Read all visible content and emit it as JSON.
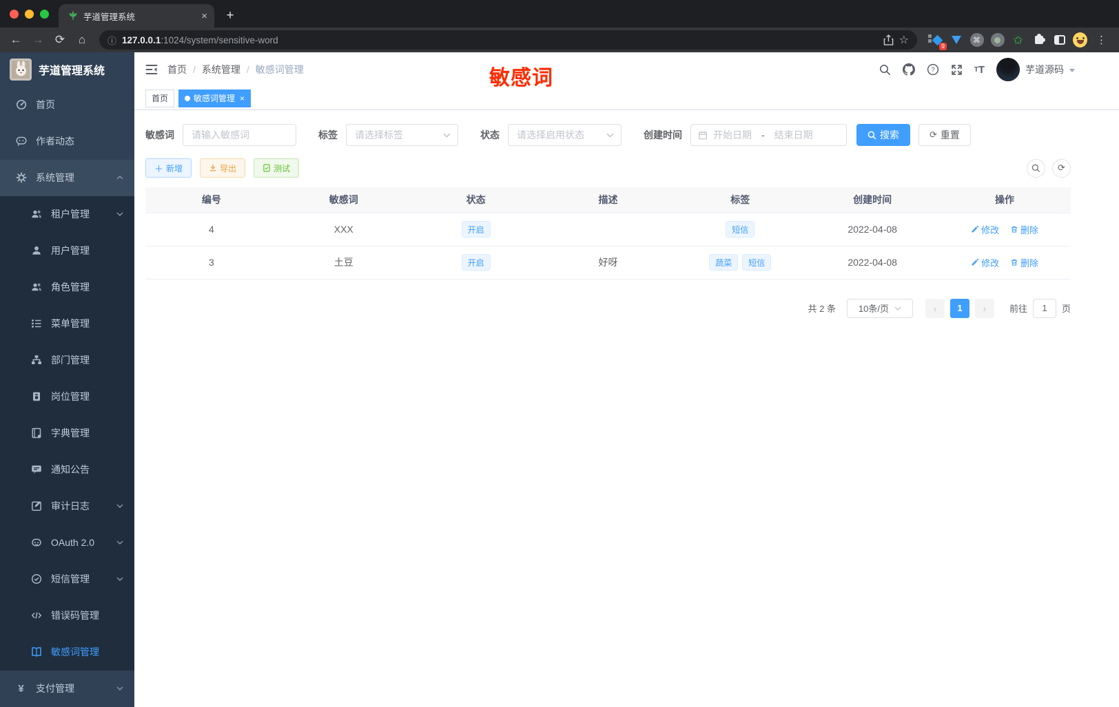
{
  "browser": {
    "tab_title": "芋道管理系统",
    "url_host": "127.0.0.1",
    "url_path": ":1024/system/sensitive-word",
    "extension_badge": "9",
    "new_tab_label": "+",
    "close_label": "×"
  },
  "sidebar": {
    "app_title": "芋道管理系统",
    "items": [
      {
        "label": "首页"
      },
      {
        "label": "作者动态"
      },
      {
        "label": "系统管理"
      },
      {
        "label": "租户管理"
      },
      {
        "label": "用户管理"
      },
      {
        "label": "角色管理"
      },
      {
        "label": "菜单管理"
      },
      {
        "label": "部门管理"
      },
      {
        "label": "岗位管理"
      },
      {
        "label": "字典管理"
      },
      {
        "label": "通知公告"
      },
      {
        "label": "审计日志"
      },
      {
        "label": "OAuth 2.0"
      },
      {
        "label": "短信管理"
      },
      {
        "label": "错误码管理"
      },
      {
        "label": "敏感词管理"
      },
      {
        "label": "支付管理"
      }
    ]
  },
  "navbar": {
    "breadcrumb": {
      "home": "首页",
      "section": "系统管理",
      "current": "敏感词管理"
    },
    "annotation": "敏感词",
    "annotation_color": "#fe2c00",
    "username": "芋道源码"
  },
  "tags_view": {
    "home": "首页",
    "active": "敏感词管理",
    "close": "×"
  },
  "filters": {
    "keyword_label": "敏感词",
    "keyword_placeholder": "请输入敏感词",
    "tag_label": "标签",
    "tag_placeholder": "请选择标签",
    "status_label": "状态",
    "status_placeholder": "请选择启用状态",
    "date_label": "创建时间",
    "date_start_placeholder": "开始日期",
    "date_separator": "-",
    "date_end_placeholder": "结束日期",
    "search_label": "搜索",
    "reset_label": "重置"
  },
  "toolbar": {
    "add_label": "新增",
    "export_label": "导出",
    "test_label": "测试"
  },
  "table": {
    "headers": {
      "id": "编号",
      "word": "敏感词",
      "status": "状态",
      "desc": "描述",
      "tags": "标签",
      "created": "创建时间",
      "ops": "操作"
    },
    "rows": [
      {
        "id": "4",
        "word": "XXX",
        "status": "开启",
        "desc": "",
        "tag1": "短信",
        "created": "2022-04-08"
      },
      {
        "id": "3",
        "word": "土豆",
        "status": "开启",
        "desc": "好呀",
        "tag1": "蔬菜",
        "tag2": "短信",
        "created": "2022-04-08"
      }
    ],
    "edit_label": "修改",
    "delete_label": "删除"
  },
  "pagination": {
    "total": "共 2 条",
    "page_size": "10条/页",
    "current_page": "1",
    "goto_label": "前往",
    "goto_value": "1",
    "page_unit": "页"
  },
  "colors": {
    "accent": "#409eff",
    "sidebar_bg": "#304156",
    "submenu_bg": "#1f2d3d",
    "success": "#67c23a",
    "warning": "#e6a23c",
    "annotation_red": "#fe2c00"
  }
}
